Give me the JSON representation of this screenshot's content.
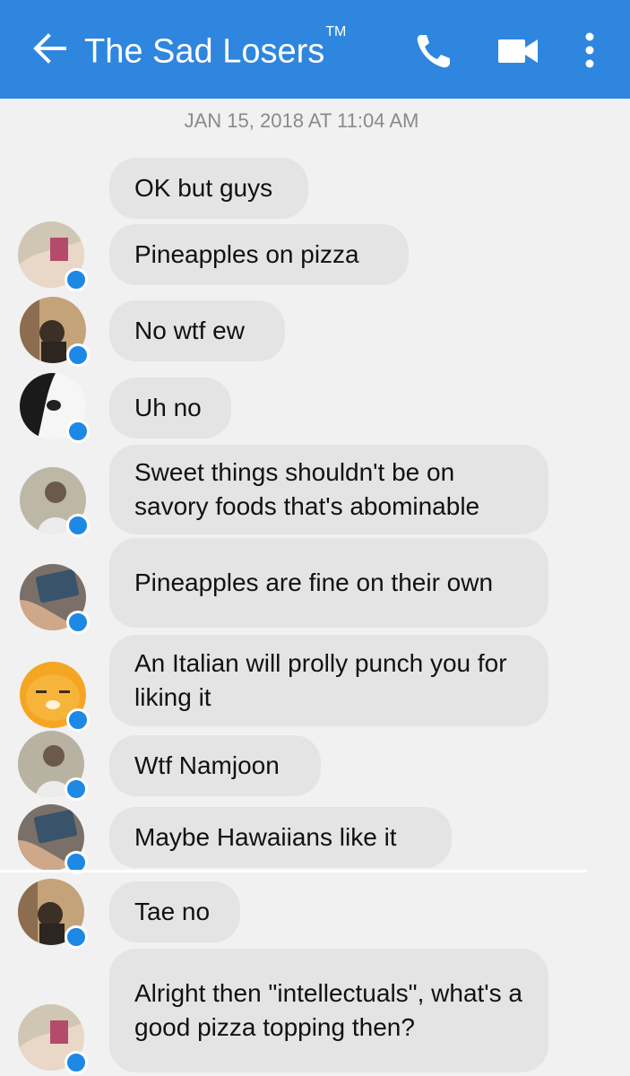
{
  "header": {
    "back_icon": "arrow-left-icon",
    "title": "The Sad Losers",
    "title_mark": "TM",
    "actions": [
      "phone-icon",
      "video-camera-icon",
      "more-vertical-icon"
    ]
  },
  "conversation": {
    "timestamp": "JAN 15, 2018 AT 11:04 AM",
    "messages": [
      {
        "text": "OK but guys"
      },
      {
        "text": "Pineapples on pizza"
      },
      {
        "text": "No wtf ew"
      },
      {
        "text": "Uh no"
      },
      {
        "text": "Sweet things shouldn't be on savory foods that's abominable"
      },
      {
        "text": "Pineapples are fine on their own"
      },
      {
        "text": "An Italian will prolly punch you for liking it"
      },
      {
        "text": "Wtf Namjoon"
      },
      {
        "text": "Maybe Hawaiians like it"
      },
      {
        "text": "Tae no"
      },
      {
        "text": "Alright then \"intellectuals\", what's a good pizza topping then?"
      }
    ]
  },
  "colors": {
    "header_bg": "#2e86de",
    "bubble_bg": "#e4e4e4",
    "messenger_badge": "#1e88e5"
  }
}
